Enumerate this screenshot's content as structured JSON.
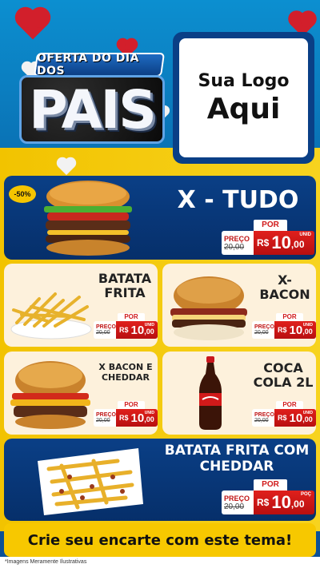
{
  "promo": {
    "subtitle": "OFERTA DO DIA DOS",
    "title": "PAIS"
  },
  "logo": {
    "line1": "Sua Logo",
    "line2": "Aqui"
  },
  "price_labels": {
    "por": "POR",
    "preco": "PREÇO",
    "currency": "R$",
    "unit": "UNID",
    "portion": "POÇ"
  },
  "products": [
    {
      "name": "X - TUDO",
      "badge": "-50%",
      "old_price": "20,00",
      "price_int": "10",
      "price_dec": ",00"
    },
    {
      "name": "BATATA FRITA",
      "old_price": "20,00",
      "price_int": "10",
      "price_dec": ",00"
    },
    {
      "name": "X-BACON",
      "old_price": "20,00",
      "price_int": "10",
      "price_dec": ",00"
    },
    {
      "name": "X BACON E CHEDDAR",
      "old_price": "20,00",
      "price_int": "10",
      "price_dec": ",00"
    },
    {
      "name": "COCA COLA 2L",
      "old_price": "20,00",
      "price_int": "10",
      "price_dec": ",00"
    },
    {
      "name": "BATATA FRITA COM CHEDDAR",
      "old_price": "20,00",
      "price_int": "10",
      "price_dec": ",00"
    }
  ],
  "cta": "Crie seu encarte com este tema!",
  "disclaimer": "*Imagens Meramente Ilustrativas"
}
